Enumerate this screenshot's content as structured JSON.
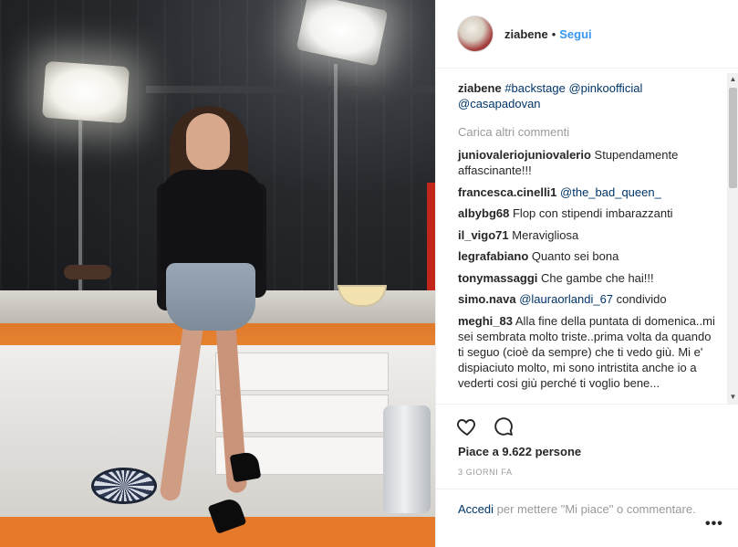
{
  "post": {
    "username": "ziabene",
    "separator": "•",
    "follow_label": "Segui",
    "caption": {
      "user": "ziabene",
      "hashtag": "#backstage",
      "mention1": "@pinkoofficial",
      "mention2": "@casapadovan"
    },
    "load_more_label": "Carica altri commenti",
    "comments": [
      {
        "user": "juniovaleriojuniovalerio",
        "text": "Stupendamente affascinante!!!"
      },
      {
        "user": "francesca.cinelli1",
        "mention": "@the_bad_queen_"
      },
      {
        "user": "albybg68",
        "text": "Flop con stipendi imbarazzanti"
      },
      {
        "user": "il_vigo71",
        "text": "Meravigliosa"
      },
      {
        "user": "legrafabiano",
        "text": "Quanto sei bona"
      },
      {
        "user": "tonymassaggi",
        "text": "Che gambe che hai!!!"
      },
      {
        "user": "simo.nava",
        "mention": "@lauraorlandi_67",
        "text": "condivido"
      },
      {
        "user": "meghi_83",
        "text": "Alla fine della puntata di domenica..mi sei sembrata molto triste..prima volta da quando ti seguo (cioè da sempre) che ti vedo giù. Mi e' dispiaciuto molto, mi sono intristita anche io a vederti cosi giù perché ti voglio bene..."
      }
    ],
    "likes_text": "Piace a 9.622 persone",
    "timestamp": "3 GIORNI FA",
    "login_link": "Accedi",
    "login_suffix": " per mettere \"Mi piace\" o commentare.",
    "more_label": "•••"
  },
  "icons": {
    "like": "heart-icon",
    "comment": "speech-bubble-icon",
    "more": "ellipsis-icon"
  },
  "colors": {
    "link_blue": "#3897f0",
    "dark_link": "#003569",
    "muted": "#999999",
    "text": "#262626"
  }
}
